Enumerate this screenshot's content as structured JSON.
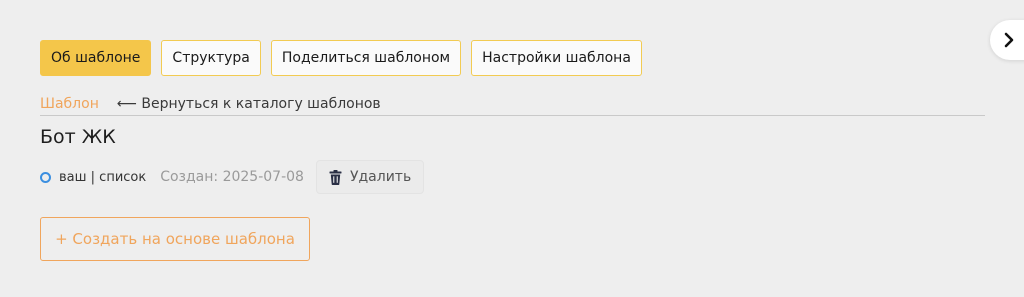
{
  "tabs": [
    {
      "label": "Об шаблоне",
      "active": true
    },
    {
      "label": "Структура",
      "active": false
    },
    {
      "label": "Поделиться шаблоном",
      "active": false
    },
    {
      "label": "Настройки шаблона",
      "active": false
    }
  ],
  "breadcrumb": {
    "current": "Шаблон",
    "back_label": "⟵ Вернуться к каталогу шаблонов"
  },
  "template": {
    "title": "Бот ЖК",
    "status": "ваш | список",
    "created": "Создан: 2025-07-08",
    "delete_label": "Удалить",
    "create_label": "+ Создать на основе шаблона"
  },
  "icons": {
    "status": "circle-outline-icon",
    "delete": "trash-icon",
    "next": "chevron-right-icon"
  },
  "colors": {
    "accent": "#f4c64a",
    "orange": "#f0a55c",
    "status_blue": "#3b8fe0",
    "background": "#eeeeee"
  }
}
